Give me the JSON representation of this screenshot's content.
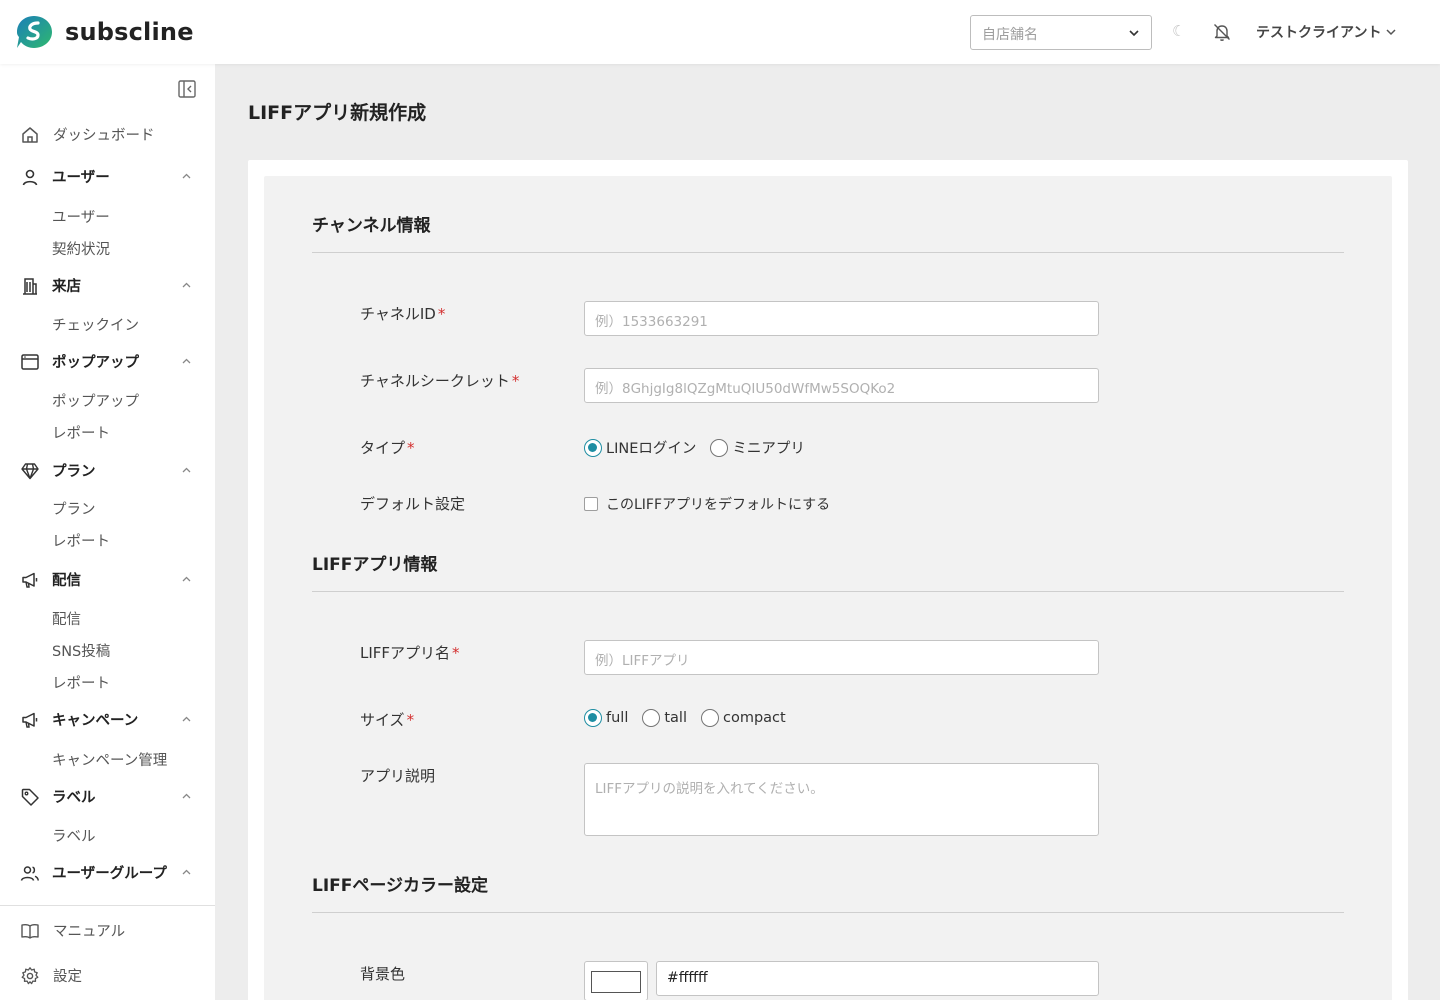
{
  "header": {
    "brand": "subscline",
    "store_placeholder": "自店舗名",
    "theme_toggle_glyph": "☾",
    "client_name": "テストクライアント"
  },
  "sidebar": {
    "dashboard": "ダッシュボード",
    "groups": [
      {
        "label": "ユーザー",
        "icon": "user-icon",
        "items": [
          "ユーザー",
          "契約状況"
        ]
      },
      {
        "label": "来店",
        "icon": "building-icon",
        "items": [
          "チェックイン"
        ]
      },
      {
        "label": "ポップアップ",
        "icon": "browser-window-icon",
        "items": [
          "ポップアップ",
          "レポート"
        ]
      },
      {
        "label": "プラン",
        "icon": "diamond-icon",
        "items": [
          "プラン",
          "レポート"
        ]
      },
      {
        "label": "配信",
        "icon": "megaphone-icon",
        "items": [
          "配信",
          "SNS投稿",
          "レポート"
        ]
      },
      {
        "label": "キャンペーン",
        "icon": "megaphone-icon",
        "items": [
          "キャンペーン管理"
        ]
      },
      {
        "label": "ラベル",
        "icon": "tag-icon",
        "items": [
          "ラベル"
        ]
      },
      {
        "label": "ユーザーグループ",
        "icon": "users-icon",
        "items": []
      }
    ],
    "manual": "マニュアル",
    "settings": "設定"
  },
  "main": {
    "page_title": "LIFFアプリ新規作成",
    "sections": {
      "channel": {
        "title": "チャンネル情報",
        "channel_id_label": "チャネルID",
        "channel_id_placeholder": "例）1533663291",
        "channel_secret_label": "チャネルシークレット",
        "channel_secret_placeholder": "例）8GhjgIg8lQZgMtuQIU50dWfMw5SOQKo2",
        "type_label": "タイプ",
        "type_options": [
          "LINEログイン",
          "ミニアプリ"
        ],
        "type_selected": "LINEログイン",
        "default_label": "デフォルト設定",
        "default_checkbox_label": "このLIFFアプリをデフォルトにする",
        "default_checked": false
      },
      "liff": {
        "title": "LIFFアプリ情報",
        "name_label": "LIFFアプリ名",
        "name_placeholder": "例）LIFFアプリ",
        "size_label": "サイズ",
        "size_options": [
          "full",
          "tall",
          "compact"
        ],
        "size_selected": "full",
        "description_label": "アプリ説明",
        "description_placeholder": "LIFFアプリの説明を入れてください。"
      },
      "color": {
        "title": "LIFFページカラー設定",
        "bg_label": "背景色",
        "bg_value": "#ffffff"
      }
    },
    "required_mark": "*"
  },
  "colors": {
    "accent": "#1f8ea3",
    "required": "#d32f2f",
    "logo_green": "#2fb86f",
    "logo_blue": "#1b7fb8"
  }
}
